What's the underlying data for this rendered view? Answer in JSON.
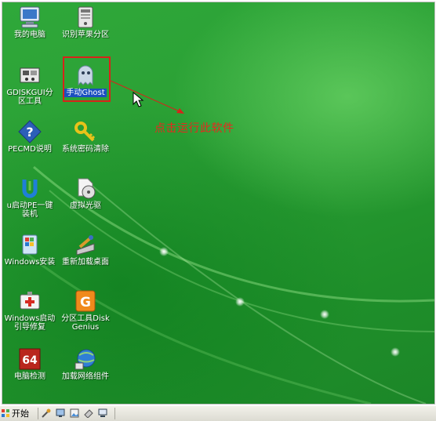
{
  "desktop": {
    "icons": [
      {
        "label": "我的电脑",
        "icon": "computer-icon"
      },
      {
        "label": "识别苹果分区",
        "icon": "drive-icon"
      },
      {
        "label": "GDISKGUI分区工具",
        "icon": "gdisk-tool-icon"
      },
      {
        "label": "手动Ghost",
        "icon": "ghost-icon"
      },
      {
        "label": "PECMD说明",
        "icon": "help-icon"
      },
      {
        "label": "系统密码清除",
        "icon": "key-icon"
      },
      {
        "label": "u启动PE一键装机",
        "icon": "u-install-icon"
      },
      {
        "label": "虚拟光驱",
        "icon": "virtual-cd-icon"
      },
      {
        "label": "Windows安装",
        "icon": "windows-setup-icon"
      },
      {
        "label": "重新加载桌面",
        "icon": "reload-desktop-icon"
      },
      {
        "label": "Windows启动引导修复",
        "icon": "boot-repair-icon"
      },
      {
        "label": "分区工具DiskGenius",
        "icon": "diskgenius-icon"
      },
      {
        "label": "电脑检测",
        "icon": "pc-check-icon"
      },
      {
        "label": "加载网络组件",
        "icon": "network-icon"
      }
    ]
  },
  "annotation": {
    "text": "点击运行此软件",
    "color": "#e8281e"
  },
  "taskbar": {
    "start_label": "开始",
    "quick_launch": [
      "tool-icon",
      "screen-icon",
      "image-icon",
      "eraser-icon",
      "monitor-icon"
    ]
  },
  "colors": {
    "desktop": "#2aa035",
    "highlight": "#d8231a",
    "selection": "#1b4fbf"
  }
}
